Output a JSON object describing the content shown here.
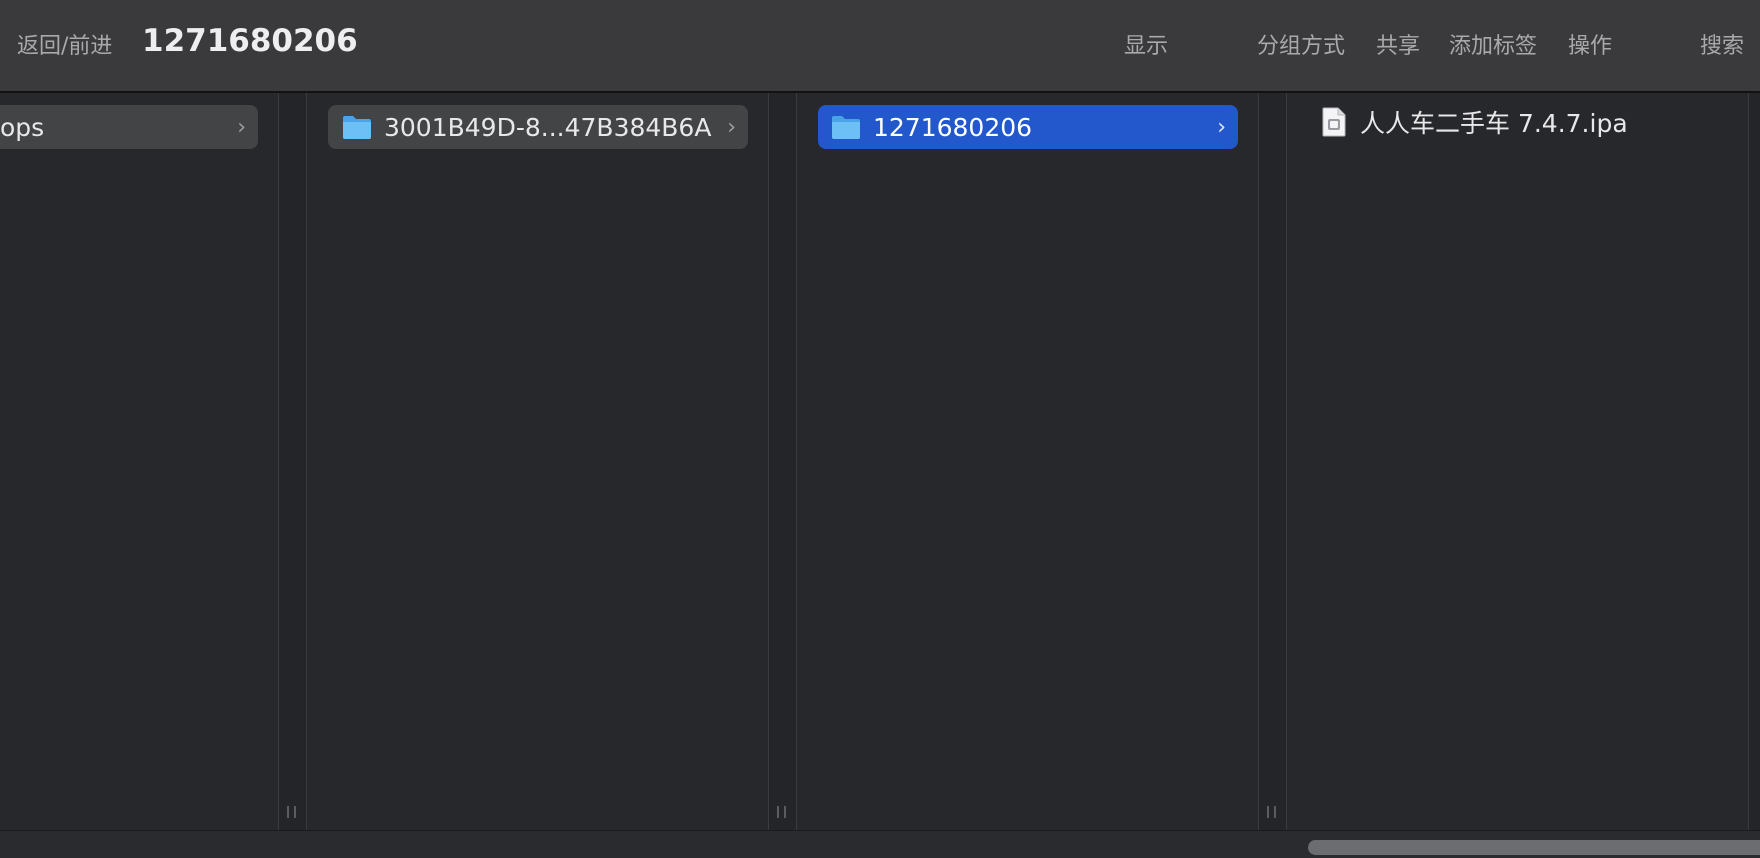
{
  "toolbar": {
    "back_forward_label": "返回/前进",
    "title": "1271680206",
    "actions": {
      "view": "显示",
      "group": "分组方式",
      "share": "共享",
      "tags": "添加标签",
      "action": "操作",
      "search": "搜索"
    }
  },
  "columns": [
    {
      "items": [
        {
          "label": "ops",
          "type": "folder",
          "state": "parent"
        }
      ]
    },
    {
      "items": [
        {
          "label": "3001B49D-8...47B384B6A",
          "type": "folder",
          "state": "parent"
        }
      ]
    },
    {
      "items": [
        {
          "label": "1271680206",
          "type": "folder",
          "state": "selected"
        }
      ]
    },
    {
      "items": [
        {
          "label": "人人车二手车 7.4.7.ipa",
          "type": "file"
        }
      ]
    }
  ],
  "colors": {
    "selection": "#2258cc",
    "parent_highlight": "#434446",
    "toolbar_bg": "#3a3a3c",
    "pane_bg": "#27282c",
    "folder_blue": "#5fb5f0"
  },
  "icons": {
    "folder": "folder-icon",
    "file": "ipa-file-icon",
    "chevron": "chevron-right-icon"
  }
}
